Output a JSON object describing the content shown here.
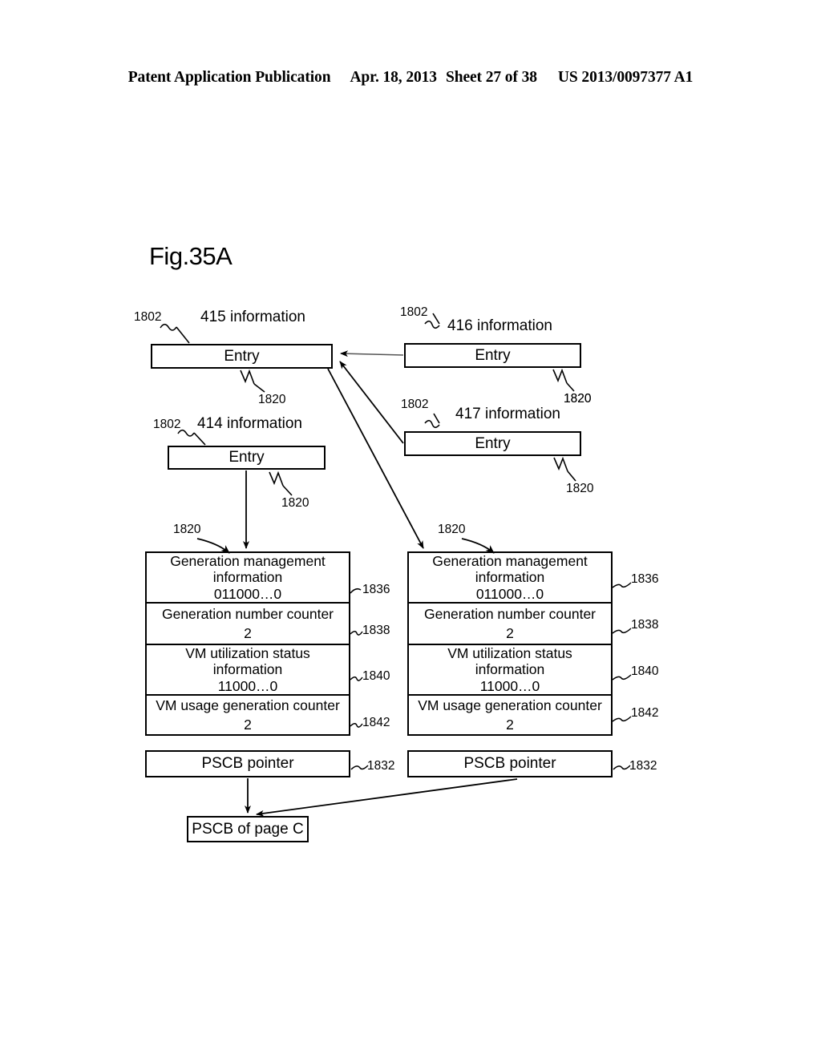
{
  "header": {
    "publication": "Patent Application Publication",
    "date": "Apr. 18, 2013",
    "sheet": "Sheet 27 of 38",
    "patent_number": "US 2013/0097377 A1"
  },
  "figure": {
    "title": "Fig.35A"
  },
  "labels": {
    "info_415": "415 information",
    "info_416": "416 information",
    "info_414": "414 information",
    "info_417": "417 information",
    "entry": "Entry",
    "pscb_pointer": "PSCB pointer",
    "pscb_of_page_c": "PSCB of page C"
  },
  "refs": {
    "r1802": "1802",
    "r1820": "1820",
    "r1832": "1832",
    "r1836": "1836",
    "r1838": "1838",
    "r1840": "1840",
    "r1842": "1842"
  },
  "tables": [
    {
      "id": "left",
      "rows": [
        {
          "label": "Generation management\ninformation",
          "value": "011000…0",
          "ref": "1836"
        },
        {
          "label": "Generation number counter",
          "value": "2",
          "ref": "1838"
        },
        {
          "label": "VM utilization status\ninformation",
          "value": "11000…0",
          "ref": "1840"
        },
        {
          "label": "VM usage  generation counter",
          "value": "2",
          "ref": "1842"
        }
      ]
    },
    {
      "id": "right",
      "rows": [
        {
          "label": "Generation management\ninformation",
          "value": "011000…0",
          "ref": "1836"
        },
        {
          "label": "Generation number counter",
          "value": "2",
          "ref": "1838"
        },
        {
          "label": "VM utilization status\ninformation",
          "value": "11000…0",
          "ref": "1840"
        },
        {
          "label": "VM usage  generation counter",
          "value": "2",
          "ref": "1842"
        }
      ]
    }
  ],
  "table_rows": {
    "gen_mgmt_l1": "Generation management",
    "gen_mgmt_l2": "information",
    "gen_mgmt_val": "011000…0",
    "gen_num_counter": "Generation number counter",
    "gen_num_counter_val": "2",
    "vm_util_l1": "VM utilization status",
    "vm_util_l2": "information",
    "vm_util_val": "11000…0",
    "vm_usage_counter": "VM usage  generation counter",
    "vm_usage_counter_val": "2"
  },
  "colors": {
    "ink": "#000000",
    "paper": "#ffffff"
  }
}
